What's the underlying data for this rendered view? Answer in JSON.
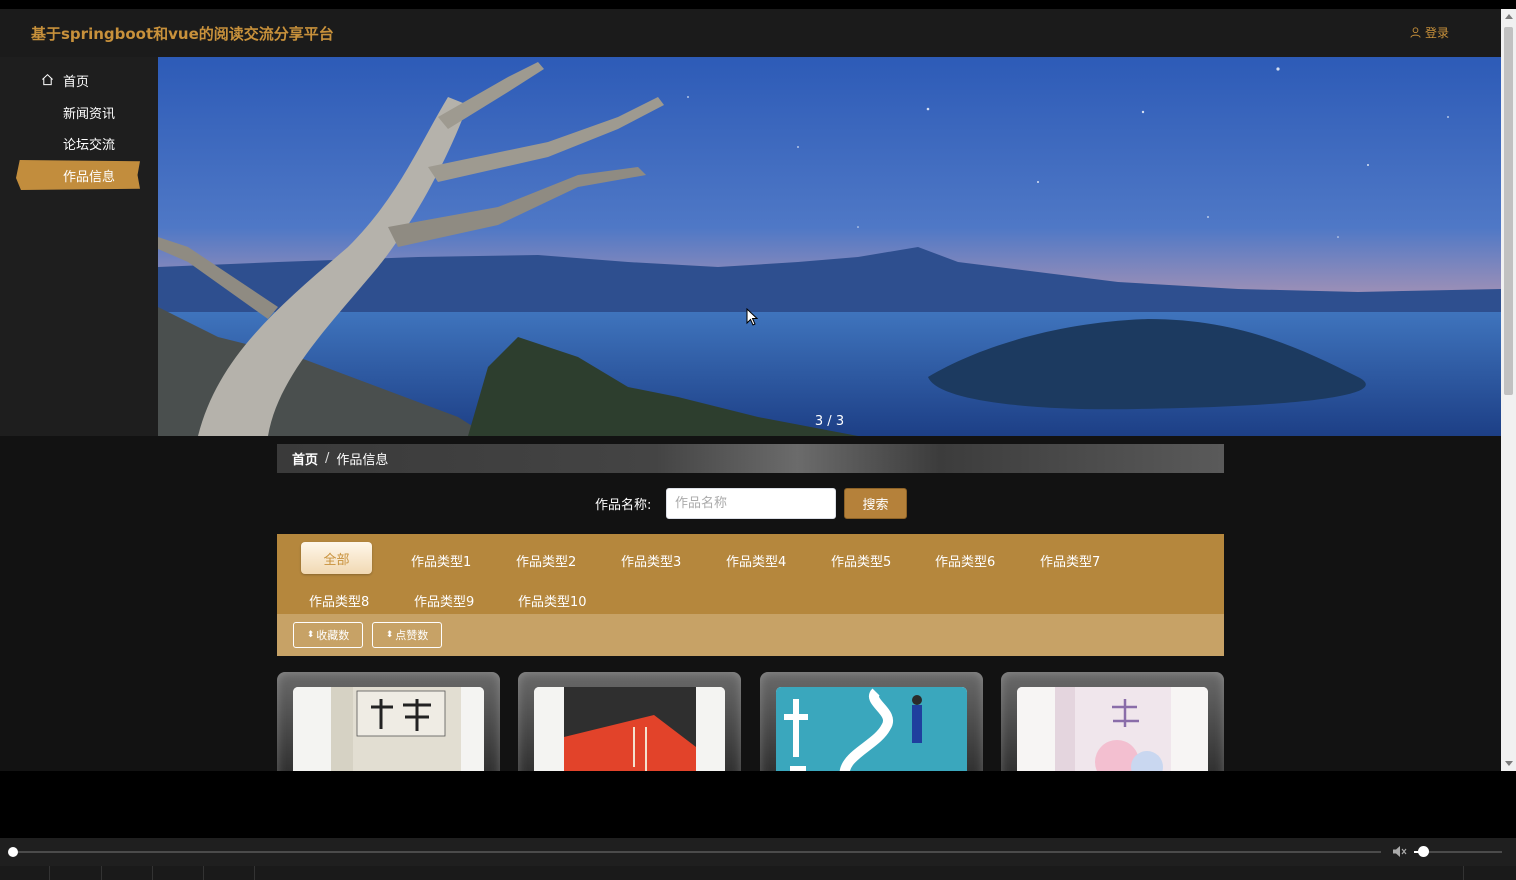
{
  "header": {
    "site_title": "基于springboot和vue的阅读交流分享平台",
    "login_label": "登录"
  },
  "sidebar": {
    "items": [
      {
        "label": "首页",
        "icon": "home-icon",
        "active": false
      },
      {
        "label": "新闻资讯",
        "active": false
      },
      {
        "label": "论坛交流",
        "active": false
      },
      {
        "label": "作品信息",
        "active": true
      }
    ]
  },
  "banner": {
    "indicator": "3 / 3",
    "current_slide": 3,
    "total_slides": 3
  },
  "breadcrumb": {
    "home": "首页",
    "separator": "/",
    "current": "作品信息"
  },
  "search": {
    "label": "作品名称:",
    "placeholder": "作品名称",
    "value": "",
    "button_label": "搜索"
  },
  "categories": {
    "all_label": "全部",
    "items": [
      "作品类型1",
      "作品类型2",
      "作品类型3",
      "作品类型4",
      "作品类型5",
      "作品类型6",
      "作品类型7",
      "作品类型8",
      "作品类型9",
      "作品类型10"
    ]
  },
  "sort": {
    "buttons": [
      {
        "caret": "⬍",
        "label": "收藏数"
      },
      {
        "caret": "⬍",
        "label": "点赞数"
      }
    ]
  },
  "colors": {
    "accent": "#c8913b",
    "category_bg": "#b5873d",
    "sort_bg": "#c7a266",
    "page_bg": "#121212"
  },
  "player": {
    "progress": 0.0,
    "volume": 0.1
  }
}
